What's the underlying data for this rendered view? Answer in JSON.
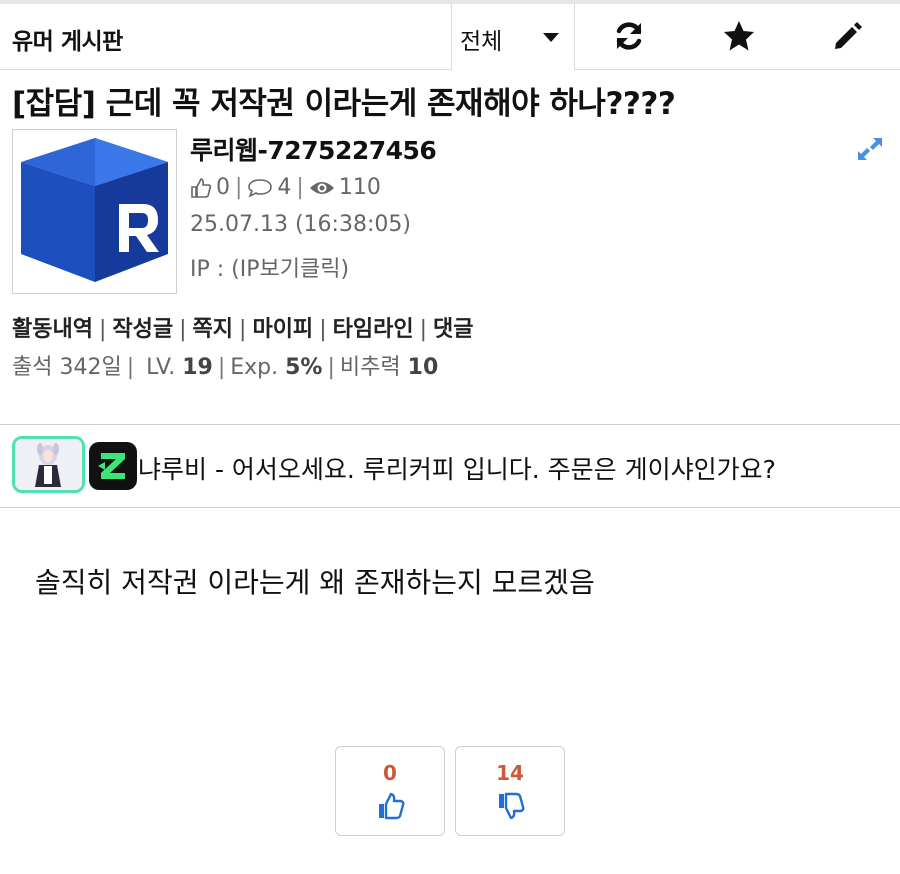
{
  "header": {
    "board_title": "유머 게시판",
    "filter_selected": "전체",
    "refresh_icon": "refresh-icon",
    "favorite_icon": "star-icon",
    "write_icon": "pencil-icon"
  },
  "post": {
    "title": "[잡담] 근데 꼭 저작권 이라는게 존재해야 하나????",
    "author": "루리웹-7275227456",
    "likes": "0",
    "comments": "4",
    "views": "110",
    "date": "25.07.13 (16:38:05)",
    "ip": "IP : (IP보기클릭)",
    "body": "솔직히 저작권 이라는게 왜 존재하는지 모르겠음"
  },
  "profile_links": [
    "활동내역",
    "작성글",
    "쪽지",
    "마이피",
    "타임라인",
    "댓글"
  ],
  "profile_meta": {
    "attendance_label": "출석 342일",
    "level_label": "LV.",
    "level_value": "19",
    "exp_label": "Exp.",
    "exp_value": "5%",
    "recommend_label": "비추력",
    "recommend_value": "10"
  },
  "greeting": "냐루비 - 어서오세요. 루리커피 입니다. 주문은 게이샤인가요?",
  "votes": {
    "up": "0",
    "down": "14"
  },
  "colors": {
    "accent_blue": "#1f6fd6",
    "vote_count": "#cc5a3a",
    "badge_green": "#52e0b0"
  }
}
